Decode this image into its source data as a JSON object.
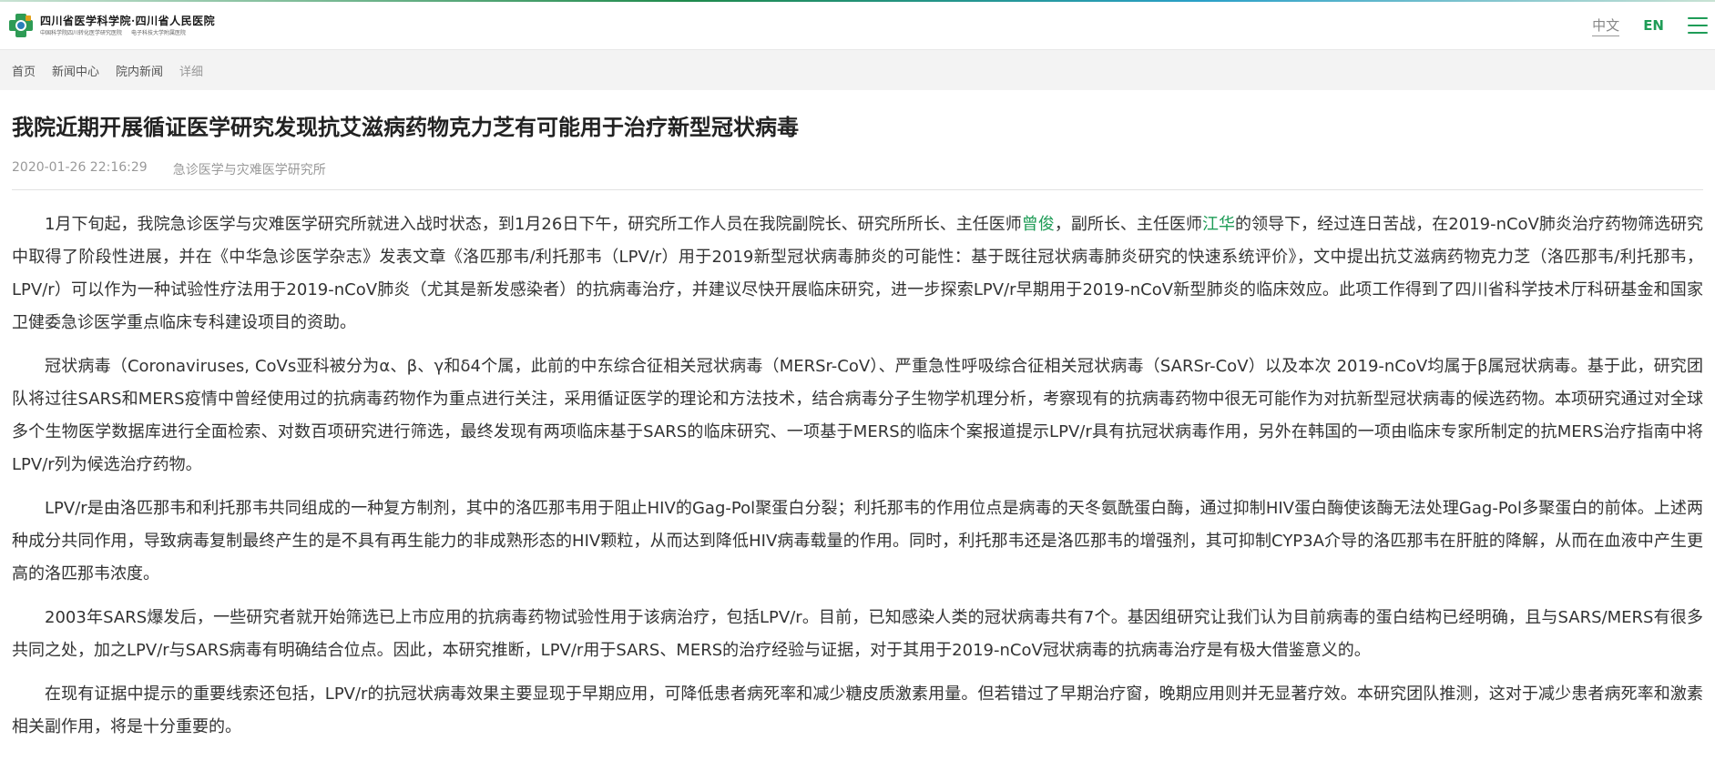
{
  "header": {
    "logo_title": "四川省医学科学院·四川省人民医院",
    "logo_sub_1": "中国科学院四川转化医学研究医院",
    "logo_sub_2": "电子科技大学附属医院",
    "lang_cn": "中文",
    "lang_en": "EN"
  },
  "breadcrumb": [
    "首页",
    "新闻中心",
    "院内新闻",
    "详细"
  ],
  "article": {
    "title": "我院近期开展循证医学研究发现抗艾滋病药物克力芝有可能用于治疗新型冠状病毒",
    "date": "2020-01-26 22:16:29",
    "source": "急诊医学与灾难医学研究所",
    "p1_part1": "1月下旬起，我院急诊医学与灾难医学研究所就进入战时状态，到1月26日下午，研究所工作人员在我院副院长、研究所所长、主任医师",
    "p1_name1": "曾俊",
    "p1_part2": "，副所长、主任医师",
    "p1_name2": "江华",
    "p1_part3": "的领导下，经过连日苦战，在2019-nCoV肺炎治疗药物筛选研究中取得了阶段性进展，并在《中华急诊医学杂志》发表文章《洛匹那韦/利托那韦（LPV/r）用于2019新型冠状病毒肺炎的可能性：基于既往冠状病毒肺炎研究的快速系统评价》，文中提出抗艾滋病药物克力芝（洛匹那韦/利托那韦，LPV/r）可以作为一种试验性疗法用于2019-nCoV肺炎（尤其是新发感染者）的抗病毒治疗，并建议尽快开展临床研究，进一步探索LPV/r早期用于2019-nCoV新型肺炎的临床效应。此项工作得到了四川省科学技术厅科研基金和国家卫健委急诊医学重点临床专科建设项目的资助。",
    "p2": "冠状病毒（Coronaviruses, CoVs亚科被分为α、β、γ和δ4个属，此前的中东综合征相关冠状病毒（MERSr-CoV）、严重急性呼吸综合征相关冠状病毒（SARSr-CoV）以及本次 2019-nCoV均属于β属冠状病毒。基于此，研究团队将过往SARS和MERS疫情中曾经使用过的抗病毒药物作为重点进行关注，采用循证医学的理论和方法技术，结合病毒分子生物学机理分析，考察现有的抗病毒药物中很无可能作为对抗新型冠状病毒的候选药物。本项研究通过对全球多个生物医学数据库进行全面检索、对数百项研究进行筛选，最终发现有两项临床基于SARS的临床研究、一项基于MERS的临床个案报道提示LPV/r具有抗冠状病毒作用，另外在韩国的一项由临床专家所制定的抗MERS治疗指南中将LPV/r列为候选治疗药物。",
    "p3": "LPV/r是由洛匹那韦和利托那韦共同组成的一种复方制剂，其中的洛匹那韦用于阻止HIV的Gag-Pol聚蛋白分裂；利托那韦的作用位点是病毒的天冬氨酰蛋白酶，通过抑制HIV蛋白酶使该酶无法处理Gag-Pol多聚蛋白的前体。上述两种成分共同作用，导致病毒复制最终产生的是不具有再生能力的非成熟形态的HIV颗粒，从而达到降低HIV病毒载量的作用。同时，利托那韦还是洛匹那韦的增强剂，其可抑制CYP3A介导的洛匹那韦在肝脏的降解，从而在血液中产生更高的洛匹那韦浓度。",
    "p4": "2003年SARS爆发后，一些研究者就开始筛选已上市应用的抗病毒药物试验性用于该病治疗，包括LPV/r。目前，已知感染人类的冠状病毒共有7个。基因组研究让我们认为目前病毒的蛋白结构已经明确，且与SARS/MERS有很多共同之处，加之LPV/r与SARS病毒有明确结合位点。因此，本研究推断，LPV/r用于SARS、MERS的治疗经验与证据，对于其用于2019-nCoV冠状病毒的抗病毒治疗是有极大借鉴意义的。",
    "p5": "在现有证据中提示的重要线索还包括，LPV/r的抗冠状病毒效果主要显现于早期应用，可降低患者病死率和减少糖皮质激素用量。但若错过了早期治疗窗，晚期应用则并无显著疗效。本研究团队推测，这对于减少患者病死率和激素相关副作用，将是十分重要的。"
  },
  "colors": {
    "accent": "#1f9c57",
    "breadcrumb_bg": "#f3f3f3"
  },
  "icons": {
    "logo": "hospital-logo-icon",
    "menu": "hamburger-menu-icon"
  }
}
